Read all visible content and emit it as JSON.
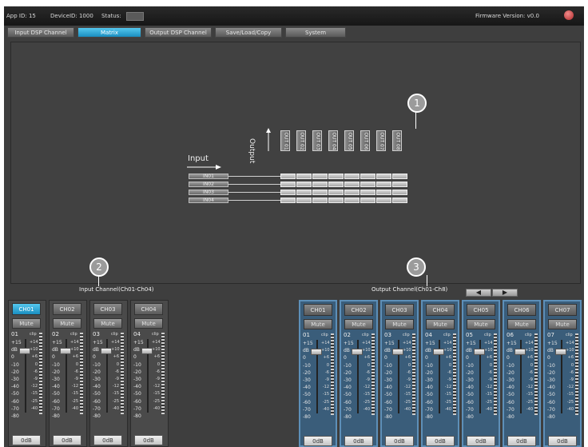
{
  "titlebar": {
    "app_id": "App ID: 15",
    "device_id": "DeviceID: 1000",
    "status_label": "Status:",
    "firmware": "Firmware Version: v0.0"
  },
  "tabs": [
    {
      "label": "Input DSP Channel",
      "active": false
    },
    {
      "label": "Matrix",
      "active": true
    },
    {
      "label": "Output DSP Channel",
      "active": false
    },
    {
      "label": "Save/Load/Copy",
      "active": false
    },
    {
      "label": "System",
      "active": false
    }
  ],
  "matrix": {
    "input_label": "Input",
    "output_label": "Output",
    "outputs": [
      "OUT 01",
      "OUT 02",
      "OUT 03",
      "OUT 04",
      "OUT 05",
      "OUT 06",
      "OUT 07",
      "OUT 08"
    ],
    "inputs": [
      "IN01",
      "IN02",
      "IN03",
      "IN04"
    ]
  },
  "callouts": [
    "1",
    "2",
    "3"
  ],
  "input_section": {
    "title": "Input Channel(Ch01-Ch04)",
    "channels": [
      {
        "name": "CH01",
        "num": "01",
        "active": true
      },
      {
        "name": "CH02",
        "num": "02",
        "active": false
      },
      {
        "name": "CH03",
        "num": "03",
        "active": false
      },
      {
        "name": "CH04",
        "num": "04",
        "active": false
      }
    ]
  },
  "output_section": {
    "title": "Output Channel(Ch01-Ch8)",
    "prev_glyph": "◀",
    "next_glyph": "▶",
    "channels": [
      {
        "name": "CH01",
        "num": "01"
      },
      {
        "name": "CH02",
        "num": "02"
      },
      {
        "name": "CH03",
        "num": "03"
      },
      {
        "name": "CH04",
        "num": "04"
      },
      {
        "name": "CH05",
        "num": "05"
      },
      {
        "name": "CH06",
        "num": "06"
      },
      {
        "name": "CH07",
        "num": "07"
      }
    ]
  },
  "strip": {
    "mute_label": "Mute",
    "clip_label": "clip",
    "db_label": "0dB",
    "scale_left": [
      "+15",
      "dB",
      "0",
      "-10",
      "-20",
      "-30",
      "-40",
      "-50",
      "-60",
      "-70",
      "-80"
    ],
    "scale_right": [
      "+14",
      "+10",
      "+6",
      "0",
      "-6",
      "-9",
      "-12",
      "-15",
      "-25",
      "-40"
    ]
  },
  "colors": {
    "accent": "#1a9fd6",
    "output_strip": "#3a5d7a",
    "panel": "#414141"
  }
}
